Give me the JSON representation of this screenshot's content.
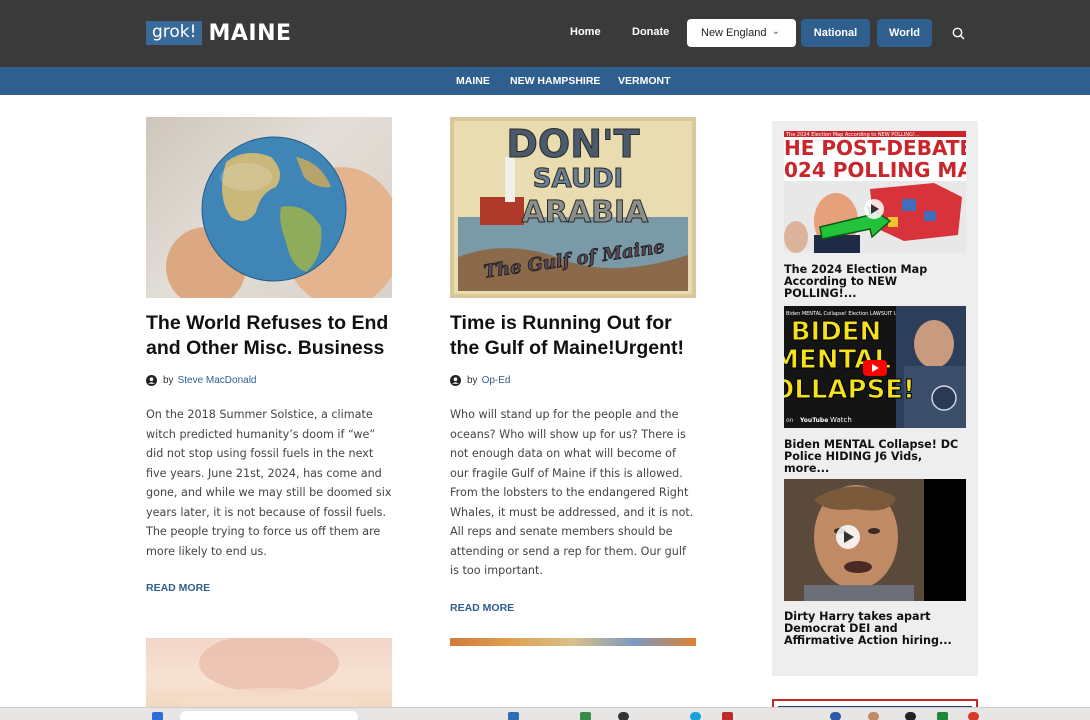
{
  "header": {
    "logo_badge": "grok!",
    "logo_text": "MAINE",
    "nav": {
      "home": "Home",
      "donate": "Donate",
      "region_select": "New England",
      "national": "National",
      "world": "World"
    },
    "icons": {
      "search": "search-icon",
      "dropdown": "chevron-down-icon"
    }
  },
  "subnav": {
    "items": [
      "MAINE",
      "NEW HAMPSHIRE",
      "VERMONT"
    ]
  },
  "articles": [
    {
      "title": "The World Refuses to End and Other Misc. Business",
      "by": "by",
      "author": "Steve MacDonald",
      "excerpt": "On the 2018 Summer Solstice, a climate witch predicted humanity’s doom if “we” did not stop using fossil fuels in the next five years. June 21st, 2024, has come and gone, and while we may still be doomed six years later, it is not because of fossil fuels. The people trying to force us off them are more likely to end us.",
      "read_more": "READ MORE"
    },
    {
      "title": "Time is Running Out for the Gulf of Maine!Urgent!",
      "by": "by",
      "author": "Op-Ed",
      "excerpt": "Who will stand up for the people and the oceans? Who will show up for us? There is not enough data on what will become of our fragile Gulf of Maine if this is allowed. From the lobsters to the endangered Right Whales, it must be addressed, and it is not. All reps and senate members should be attending or send a rep for them. Our gulf is too important.",
      "read_more": "READ MORE",
      "image_text": {
        "line1": "DON'T",
        "line2": "SAUDI",
        "line3": "ARABIA",
        "line4": "The Gulf of Maine"
      }
    }
  ],
  "sidebar": {
    "videos": [
      {
        "title": "The 2024 Election Map According to NEW POLLING!...",
        "thumb_caption": "The 2024 Election Map According to NEW POLLING!...",
        "thumb_line1": "HE POST-DEBATE",
        "thumb_line2": "024 POLLING MA"
      },
      {
        "title": "Biden MENTAL Collapse! DC Police HIDING J6 Vids, more...",
        "thumb_caption": "Biden MENTAL Collapse! Election LAWSUIT Update!...",
        "thumb_line1": "BIDEN",
        "thumb_line2": "MENTAL",
        "thumb_line3": "COLLAPSE!",
        "watch": "Watch",
        "on": "on",
        "youtube": "YouTube"
      },
      {
        "title": "Dirty Harry takes apart Democrat DEI and Affirmative Action hiring..."
      }
    ]
  },
  "colors": {
    "topbar": "#3a3a3a",
    "accent_blue": "#2f5f8f",
    "logo_badge": "#3a6a9a",
    "sidebar_bg": "#eeeeee"
  }
}
